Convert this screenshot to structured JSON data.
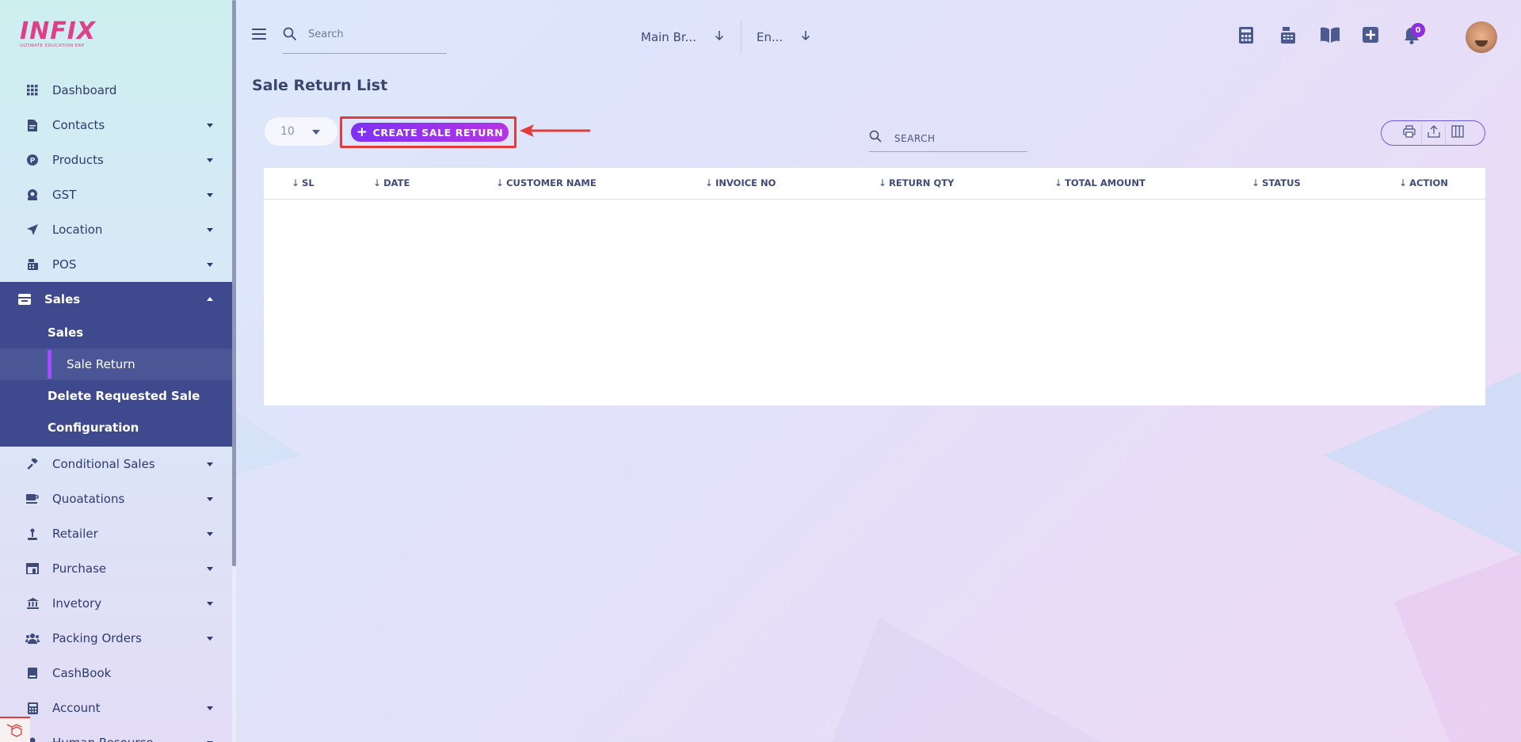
{
  "brand": {
    "logo_text": "INFIX",
    "logo_sub": "ULTIMATE EDUCATION ERP"
  },
  "sidebar": {
    "items": [
      {
        "label": "Dashboard",
        "icon": "grid-icon",
        "caret": false
      },
      {
        "label": "Contacts",
        "icon": "contacts-icon",
        "caret": true
      },
      {
        "label": "Products",
        "icon": "product-icon",
        "caret": true
      },
      {
        "label": "GST",
        "icon": "gst-icon",
        "caret": true
      },
      {
        "label": "Location",
        "icon": "location-arrow-icon",
        "caret": true
      },
      {
        "label": "POS",
        "icon": "cash-register-icon",
        "caret": true
      }
    ],
    "sales_group": {
      "label": "Sales",
      "icon": "store-icon",
      "children": [
        {
          "label": "Sales",
          "active": false
        },
        {
          "label": "Sale Return",
          "active": true
        },
        {
          "label": "Delete Requested Sale",
          "active": false
        },
        {
          "label": "Configuration",
          "active": false
        }
      ]
    },
    "items_after": [
      {
        "label": "Conditional Sales",
        "icon": "gavel-icon",
        "caret": true
      },
      {
        "label": "Quoatations",
        "icon": "coffee-icon",
        "caret": true
      },
      {
        "label": "Retailer",
        "icon": "person-icon",
        "caret": true
      },
      {
        "label": "Purchase",
        "icon": "shop-icon",
        "caret": true
      },
      {
        "label": "Invetory",
        "icon": "bank-icon",
        "caret": true
      },
      {
        "label": "Packing Orders",
        "icon": "users-icon",
        "caret": true
      },
      {
        "label": "CashBook",
        "icon": "book-icon",
        "caret": false
      },
      {
        "label": "Account",
        "icon": "calculator-icon",
        "caret": true
      },
      {
        "label": "Human Resource",
        "icon": "user-icon",
        "caret": true
      }
    ]
  },
  "topbar": {
    "search_placeholder": "Search",
    "branch": "Main Br...",
    "language": "En...",
    "notifications_count": "0"
  },
  "page": {
    "title": "Sale Return List",
    "per_page": "10",
    "create_button": "CREATE SALE RETURN",
    "table_search_placeholder": "SEARCH"
  },
  "table": {
    "columns": [
      "SL",
      "DATE",
      "CUSTOMER NAME",
      "INVOICE NO",
      "RETURN QTY",
      "TOTAL AMOUNT",
      "STATUS",
      "ACTION"
    ],
    "rows": []
  },
  "colors": {
    "sidebar_active_bg": "#3f4a8e",
    "accent_purple": "#7c31f5",
    "annotation_red": "#e23b3b"
  }
}
